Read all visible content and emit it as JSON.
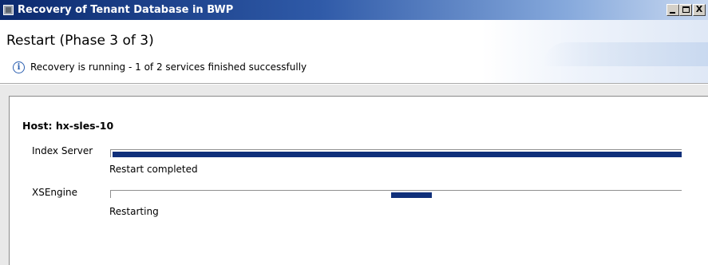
{
  "window": {
    "title": "Recovery of Tenant Database in BWP",
    "controls": {
      "minimize_icon": "minimize-icon",
      "maximize_icon": "maximize-icon",
      "close_label": "X"
    }
  },
  "header": {
    "phase_title": "Restart (Phase 3 of 3)",
    "info_glyph": "i",
    "status": "Recovery is running - 1 of 2 services finished successfully"
  },
  "host": {
    "title": "Host: hx-sles-10",
    "services": [
      {
        "name": "Index Server",
        "status": "Restart completed",
        "progress": 1.0,
        "mode": "determinate"
      },
      {
        "name": "XSEngine",
        "status": "Restarting",
        "progress": null,
        "mode": "indeterminate"
      }
    ]
  },
  "colors": {
    "progress_fill": "#10307a",
    "titlebar_start": "#0b2a6e",
    "titlebar_end": "#c8d8f0",
    "info_icon": "#2b5fb0"
  }
}
